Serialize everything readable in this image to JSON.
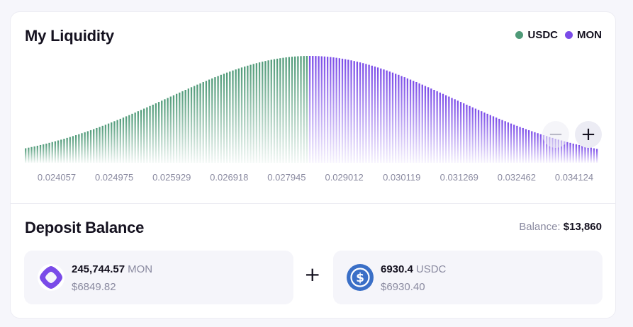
{
  "liquidity": {
    "title": "My Liquidity",
    "legend": [
      {
        "label": "USDC",
        "color": "#4f9a78"
      },
      {
        "label": "MON",
        "color": "#7a4be8"
      }
    ],
    "zoom_out_label": "−",
    "zoom_in_label": "+"
  },
  "chart_data": {
    "type": "bar",
    "x_tick_labels": [
      "0.024057",
      "0.024975",
      "0.025929",
      "0.026918",
      "0.027945",
      "0.029012",
      "0.030119",
      "0.031269",
      "0.032462",
      "0.034124"
    ],
    "series": [
      {
        "name": "USDC",
        "color": "#4f9a78",
        "bar_count": 96
      },
      {
        "name": "MON",
        "color": "#7a4be8",
        "bar_count": 98
      }
    ],
    "peak_relative_height": 1.0,
    "left_edge_relative_height": 0.13,
    "right_edge_relative_height": 0.13,
    "grid": false
  },
  "deposit": {
    "title": "Deposit Balance",
    "balance_label": "Balance:",
    "balance_value": "$13,860",
    "plus": "+",
    "tokens": [
      {
        "amount": "245,744.57",
        "symbol": "MON",
        "usd": "$6849.82",
        "icon": "mon-logo-icon",
        "color": "#7a4be8"
      },
      {
        "amount": "6930.4",
        "symbol": "USDC",
        "usd": "$6930.40",
        "icon": "usdc-logo-icon",
        "color": "#3a6fc7"
      }
    ]
  }
}
